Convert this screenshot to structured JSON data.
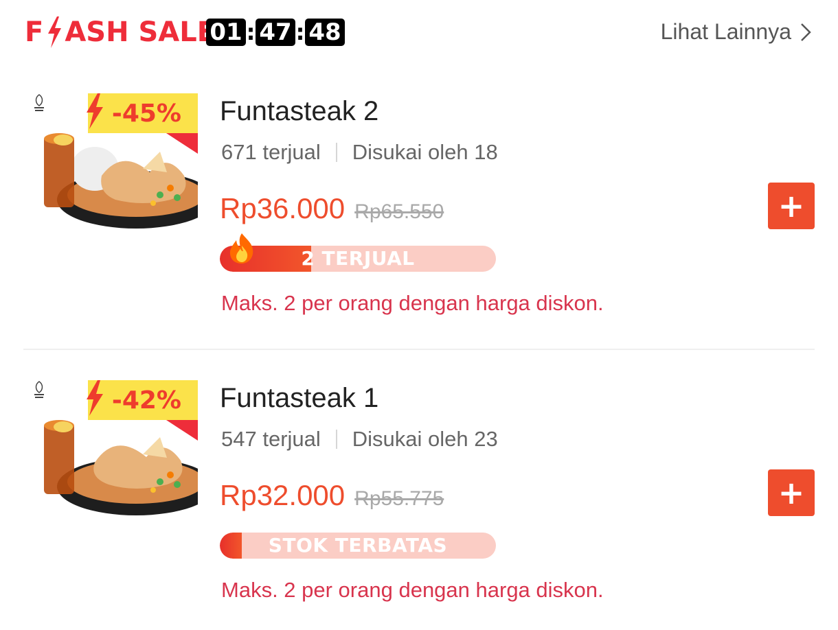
{
  "header": {
    "brand_pre": "F",
    "brand_post": "ASH SALE",
    "timer": {
      "hours": "01",
      "minutes": "47",
      "seconds": "48"
    },
    "see_more": "Lihat Lainnya"
  },
  "colors": {
    "accent": "#ee4d2d",
    "brand_red": "#ee2d3a",
    "limit_text": "#d8344d",
    "discount_bg": "#fbe24a"
  },
  "products": [
    {
      "name": "Funtasteak 2",
      "sold": "671 terjual",
      "likes": "Disukai oleh 18",
      "price": "Rp36.000",
      "original_price": "Rp65.550",
      "discount": "-45%",
      "bar_label": "2 TERJUAL",
      "bar_progress": 0.33,
      "limit": "Maks. 2 per orang dengan harga diskon.",
      "add_label": "+",
      "has_rice": true
    },
    {
      "name": "Funtasteak 1",
      "sold": "547 terjual",
      "likes": "Disukai oleh 23",
      "price": "Rp32.000",
      "original_price": "Rp55.775",
      "discount": "-42%",
      "bar_label": "STOK TERBATAS",
      "bar_progress": 0.08,
      "limit": "Maks. 2 per orang dengan harga diskon.",
      "add_label": "+",
      "has_rice": false
    }
  ]
}
